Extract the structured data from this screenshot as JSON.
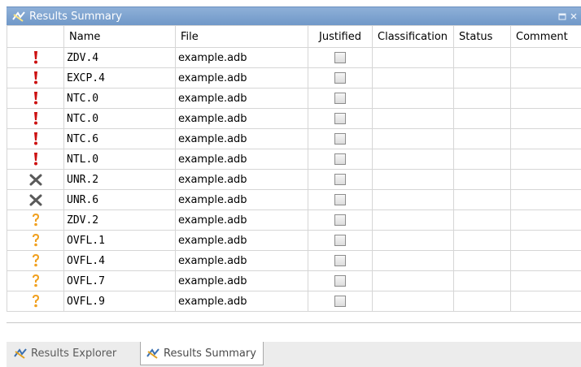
{
  "panel": {
    "title": "Results Summary"
  },
  "columns": {
    "name": "Name",
    "file": "File",
    "justified": "Justified",
    "classification": "Classification",
    "status": "Status",
    "comment": "Comment"
  },
  "rows": [
    {
      "icon": "red-exclamation-icon",
      "name": "ZDV.4",
      "file": "example.adb"
    },
    {
      "icon": "red-exclamation-icon",
      "name": "EXCP.4",
      "file": "example.adb"
    },
    {
      "icon": "red-exclamation-icon",
      "name": "NTC.0",
      "file": "example.adb"
    },
    {
      "icon": "red-exclamation-icon",
      "name": "NTC.0",
      "file": "example.adb"
    },
    {
      "icon": "red-exclamation-icon",
      "name": "NTC.6",
      "file": "example.adb"
    },
    {
      "icon": "red-exclamation-icon",
      "name": "NTL.0",
      "file": "example.adb"
    },
    {
      "icon": "gray-x-icon",
      "name": "UNR.2",
      "file": "example.adb"
    },
    {
      "icon": "gray-x-icon",
      "name": "UNR.6",
      "file": "example.adb"
    },
    {
      "icon": "orange-question-icon",
      "name": "ZDV.2",
      "file": "example.adb"
    },
    {
      "icon": "orange-question-icon",
      "name": "OVFL.1",
      "file": "example.adb"
    },
    {
      "icon": "orange-question-icon",
      "name": "OVFL.4",
      "file": "example.adb"
    },
    {
      "icon": "orange-question-icon",
      "name": "OVFL.7",
      "file": "example.adb"
    },
    {
      "icon": "orange-question-icon",
      "name": "OVFL.9",
      "file": "example.adb"
    }
  ],
  "tabs": [
    {
      "label": "Results Explorer",
      "icon": "results-icon",
      "active": false
    },
    {
      "label": "Results Summary",
      "icon": "results-icon",
      "active": true
    }
  ],
  "colors": {
    "title_bar": "#7ea3d1",
    "red_icon": "#cc1111",
    "orange_icon": "#f0a020",
    "gray_icon": "#555555"
  }
}
